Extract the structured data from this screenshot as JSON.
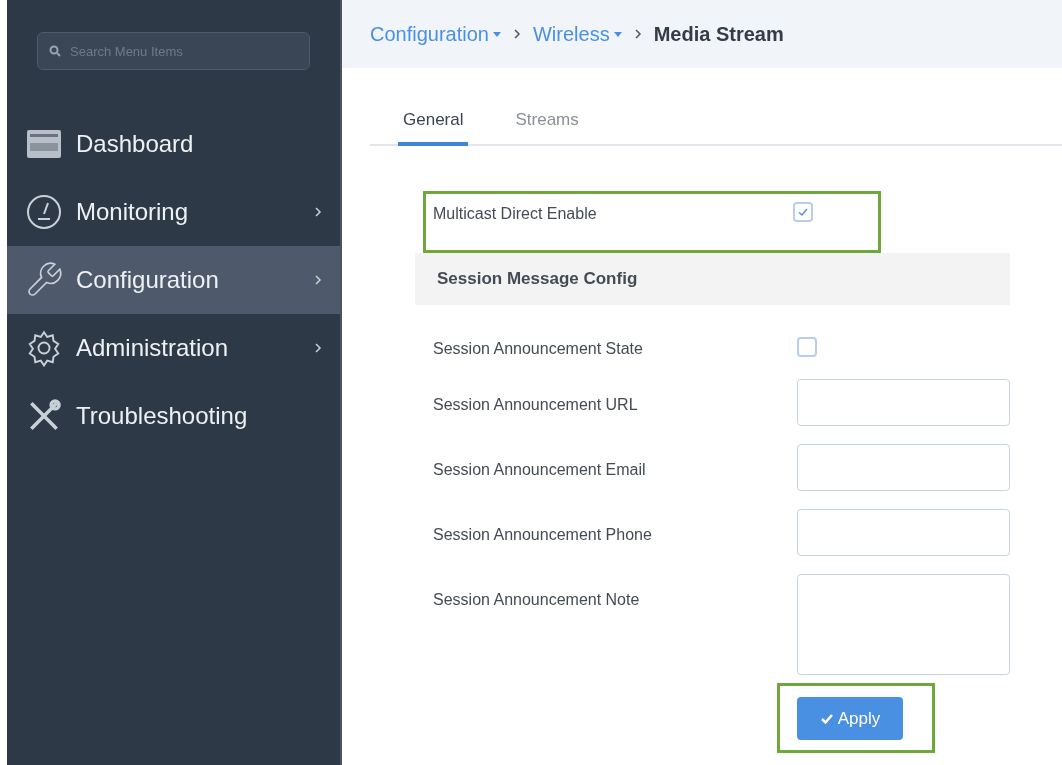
{
  "sidebar": {
    "search": {
      "placeholder": "Search Menu Items"
    },
    "items": [
      {
        "label": "Dashboard",
        "selected": false,
        "has_submenu": false
      },
      {
        "label": "Monitoring",
        "selected": false,
        "has_submenu": true
      },
      {
        "label": "Configuration",
        "selected": true,
        "has_submenu": true
      },
      {
        "label": "Administration",
        "selected": false,
        "has_submenu": true
      },
      {
        "label": "Troubleshooting",
        "selected": false,
        "has_submenu": false
      }
    ]
  },
  "breadcrumb": [
    {
      "label": "Configuration",
      "kind": "link"
    },
    {
      "label": "Wireless",
      "kind": "link"
    },
    {
      "label": "Media Stream",
      "kind": "current"
    }
  ],
  "tabs": [
    {
      "label": "General",
      "selected": true
    },
    {
      "label": "Streams",
      "selected": false
    }
  ],
  "multicast": {
    "label": "Multicast Direct Enable",
    "checked": true,
    "highlighted": true
  },
  "section": {
    "title": "Session Message Config"
  },
  "fields": [
    {
      "label": "Session Announcement State",
      "kind": "checkbox",
      "checked": false
    },
    {
      "label": "Session Announcement URL",
      "kind": "text"
    },
    {
      "label": "Session Announcement Email",
      "kind": "text"
    },
    {
      "label": "Session Announcement Phone",
      "kind": "text"
    },
    {
      "label": "Session Announcement Note",
      "kind": "textarea"
    }
  ],
  "apply": {
    "label": "Apply",
    "highlighted": true
  }
}
